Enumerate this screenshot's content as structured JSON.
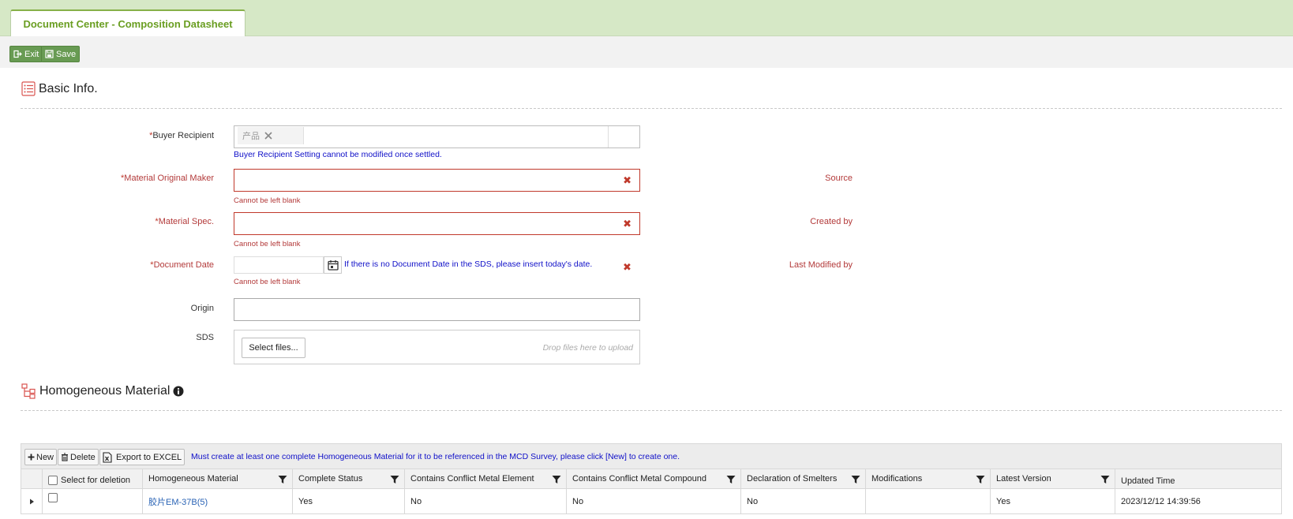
{
  "tab": {
    "title": "Document Center - Composition Datasheet"
  },
  "toolbar": {
    "exit_label": "Exit",
    "save_label": "Save"
  },
  "basic_info": {
    "title": "Basic Info.",
    "buyer_recipient": {
      "label": "Buyer Recipient",
      "chip_text": "产品",
      "note": "Buyer Recipient Setting cannot be modified once settled."
    },
    "material_original_maker": {
      "label": "Material Original Maker",
      "value": "",
      "error": "Cannot be left blank"
    },
    "material_spec": {
      "label": "Material Spec.",
      "value": "",
      "error": "Cannot be left blank"
    },
    "document_date": {
      "label": "Document Date",
      "value": "",
      "hint": "If there is no Document Date in the SDS, please insert today's date.",
      "error": "Cannot be left blank"
    },
    "origin": {
      "label": "Origin",
      "value": ""
    },
    "sds": {
      "label": "SDS",
      "select_label": "Select files...",
      "drop_hint": "Drop files here to upload"
    },
    "source_label": "Source",
    "created_by_label": "Created by",
    "last_modified_by_label": "Last Modified by"
  },
  "homogeneous": {
    "title": "Homogeneous Material",
    "toolbar": {
      "new_label": "New",
      "delete_label": "Delete",
      "export_label": "Export to EXCEL"
    },
    "note": "Must create at least one complete Homogeneous Material for it to be referenced in the MCD Survey, please click [New] to create one.",
    "columns": [
      "Select for deletion",
      "Homogeneous Material",
      "Complete Status",
      "Contains Conflict Metal Element",
      "Contains Conflict Metal Compound",
      "Declaration of Smelters",
      "Modifications",
      "Latest Version",
      "Updated Time"
    ],
    "rows": [
      {
        "material": "胶片EM-37B(5)",
        "complete": "Yes",
        "element": "No",
        "compound": "No",
        "smelters": "No",
        "modifications": "",
        "latest": "Yes",
        "updated": "2023/12/12 14:39:56"
      }
    ]
  },
  "colors": {
    "accent_green": "#689b53",
    "tab_green": "#6a9e22",
    "error_red": "#b33a3a",
    "info_blue": "#1010c8"
  }
}
